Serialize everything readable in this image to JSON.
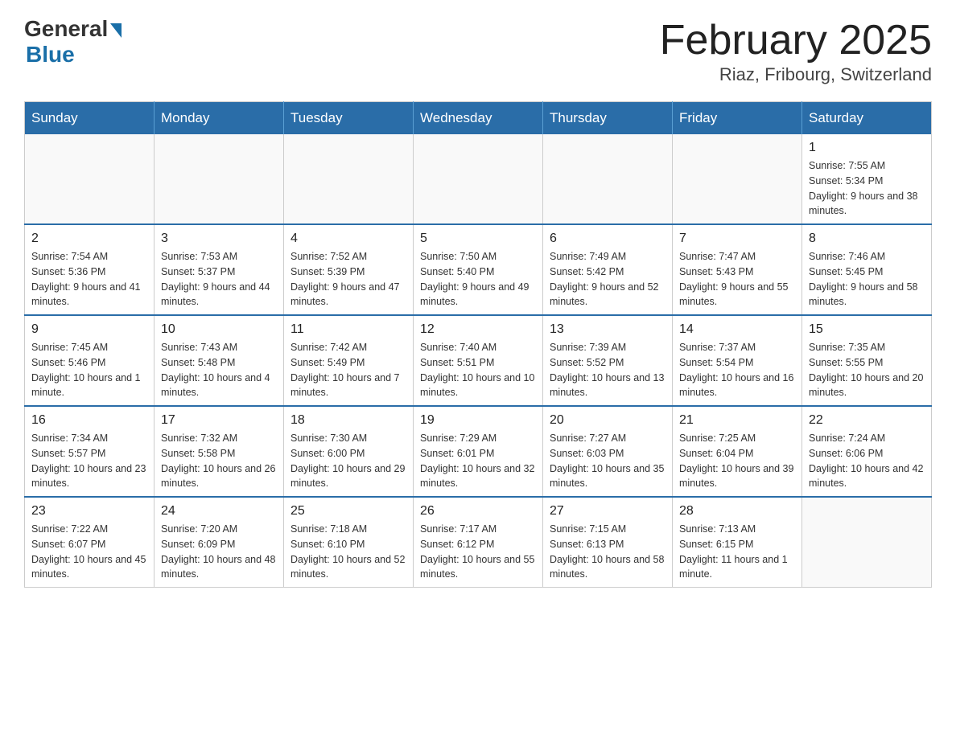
{
  "header": {
    "logo_general": "General",
    "logo_blue": "Blue",
    "month_title": "February 2025",
    "location": "Riaz, Fribourg, Switzerland"
  },
  "days_of_week": [
    "Sunday",
    "Monday",
    "Tuesday",
    "Wednesday",
    "Thursday",
    "Friday",
    "Saturday"
  ],
  "weeks": [
    [
      {
        "day": "",
        "info": ""
      },
      {
        "day": "",
        "info": ""
      },
      {
        "day": "",
        "info": ""
      },
      {
        "day": "",
        "info": ""
      },
      {
        "day": "",
        "info": ""
      },
      {
        "day": "",
        "info": ""
      },
      {
        "day": "1",
        "info": "Sunrise: 7:55 AM\nSunset: 5:34 PM\nDaylight: 9 hours and 38 minutes."
      }
    ],
    [
      {
        "day": "2",
        "info": "Sunrise: 7:54 AM\nSunset: 5:36 PM\nDaylight: 9 hours and 41 minutes."
      },
      {
        "day": "3",
        "info": "Sunrise: 7:53 AM\nSunset: 5:37 PM\nDaylight: 9 hours and 44 minutes."
      },
      {
        "day": "4",
        "info": "Sunrise: 7:52 AM\nSunset: 5:39 PM\nDaylight: 9 hours and 47 minutes."
      },
      {
        "day": "5",
        "info": "Sunrise: 7:50 AM\nSunset: 5:40 PM\nDaylight: 9 hours and 49 minutes."
      },
      {
        "day": "6",
        "info": "Sunrise: 7:49 AM\nSunset: 5:42 PM\nDaylight: 9 hours and 52 minutes."
      },
      {
        "day": "7",
        "info": "Sunrise: 7:47 AM\nSunset: 5:43 PM\nDaylight: 9 hours and 55 minutes."
      },
      {
        "day": "8",
        "info": "Sunrise: 7:46 AM\nSunset: 5:45 PM\nDaylight: 9 hours and 58 minutes."
      }
    ],
    [
      {
        "day": "9",
        "info": "Sunrise: 7:45 AM\nSunset: 5:46 PM\nDaylight: 10 hours and 1 minute."
      },
      {
        "day": "10",
        "info": "Sunrise: 7:43 AM\nSunset: 5:48 PM\nDaylight: 10 hours and 4 minutes."
      },
      {
        "day": "11",
        "info": "Sunrise: 7:42 AM\nSunset: 5:49 PM\nDaylight: 10 hours and 7 minutes."
      },
      {
        "day": "12",
        "info": "Sunrise: 7:40 AM\nSunset: 5:51 PM\nDaylight: 10 hours and 10 minutes."
      },
      {
        "day": "13",
        "info": "Sunrise: 7:39 AM\nSunset: 5:52 PM\nDaylight: 10 hours and 13 minutes."
      },
      {
        "day": "14",
        "info": "Sunrise: 7:37 AM\nSunset: 5:54 PM\nDaylight: 10 hours and 16 minutes."
      },
      {
        "day": "15",
        "info": "Sunrise: 7:35 AM\nSunset: 5:55 PM\nDaylight: 10 hours and 20 minutes."
      }
    ],
    [
      {
        "day": "16",
        "info": "Sunrise: 7:34 AM\nSunset: 5:57 PM\nDaylight: 10 hours and 23 minutes."
      },
      {
        "day": "17",
        "info": "Sunrise: 7:32 AM\nSunset: 5:58 PM\nDaylight: 10 hours and 26 minutes."
      },
      {
        "day": "18",
        "info": "Sunrise: 7:30 AM\nSunset: 6:00 PM\nDaylight: 10 hours and 29 minutes."
      },
      {
        "day": "19",
        "info": "Sunrise: 7:29 AM\nSunset: 6:01 PM\nDaylight: 10 hours and 32 minutes."
      },
      {
        "day": "20",
        "info": "Sunrise: 7:27 AM\nSunset: 6:03 PM\nDaylight: 10 hours and 35 minutes."
      },
      {
        "day": "21",
        "info": "Sunrise: 7:25 AM\nSunset: 6:04 PM\nDaylight: 10 hours and 39 minutes."
      },
      {
        "day": "22",
        "info": "Sunrise: 7:24 AM\nSunset: 6:06 PM\nDaylight: 10 hours and 42 minutes."
      }
    ],
    [
      {
        "day": "23",
        "info": "Sunrise: 7:22 AM\nSunset: 6:07 PM\nDaylight: 10 hours and 45 minutes."
      },
      {
        "day": "24",
        "info": "Sunrise: 7:20 AM\nSunset: 6:09 PM\nDaylight: 10 hours and 48 minutes."
      },
      {
        "day": "25",
        "info": "Sunrise: 7:18 AM\nSunset: 6:10 PM\nDaylight: 10 hours and 52 minutes."
      },
      {
        "day": "26",
        "info": "Sunrise: 7:17 AM\nSunset: 6:12 PM\nDaylight: 10 hours and 55 minutes."
      },
      {
        "day": "27",
        "info": "Sunrise: 7:15 AM\nSunset: 6:13 PM\nDaylight: 10 hours and 58 minutes."
      },
      {
        "day": "28",
        "info": "Sunrise: 7:13 AM\nSunset: 6:15 PM\nDaylight: 11 hours and 1 minute."
      },
      {
        "day": "",
        "info": ""
      }
    ]
  ]
}
